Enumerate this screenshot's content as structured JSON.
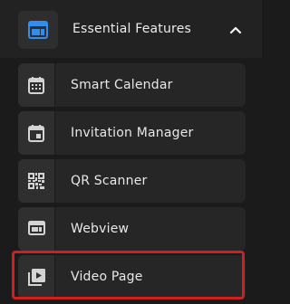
{
  "header": {
    "title": "Essential Features",
    "icon": "webview-panel-icon",
    "expanded": true,
    "accent_color": "#2f8ef0"
  },
  "items": [
    {
      "label": "Smart Calendar",
      "icon": "calendar-icon"
    },
    {
      "label": "Invitation Manager",
      "icon": "event-icon"
    },
    {
      "label": "QR Scanner",
      "icon": "qr-code-icon"
    },
    {
      "label": "Webview",
      "icon": "webview-icon"
    },
    {
      "label": "Video Page",
      "icon": "video-library-icon",
      "highlighted": true
    }
  ],
  "highlight_color": "#d0201e"
}
